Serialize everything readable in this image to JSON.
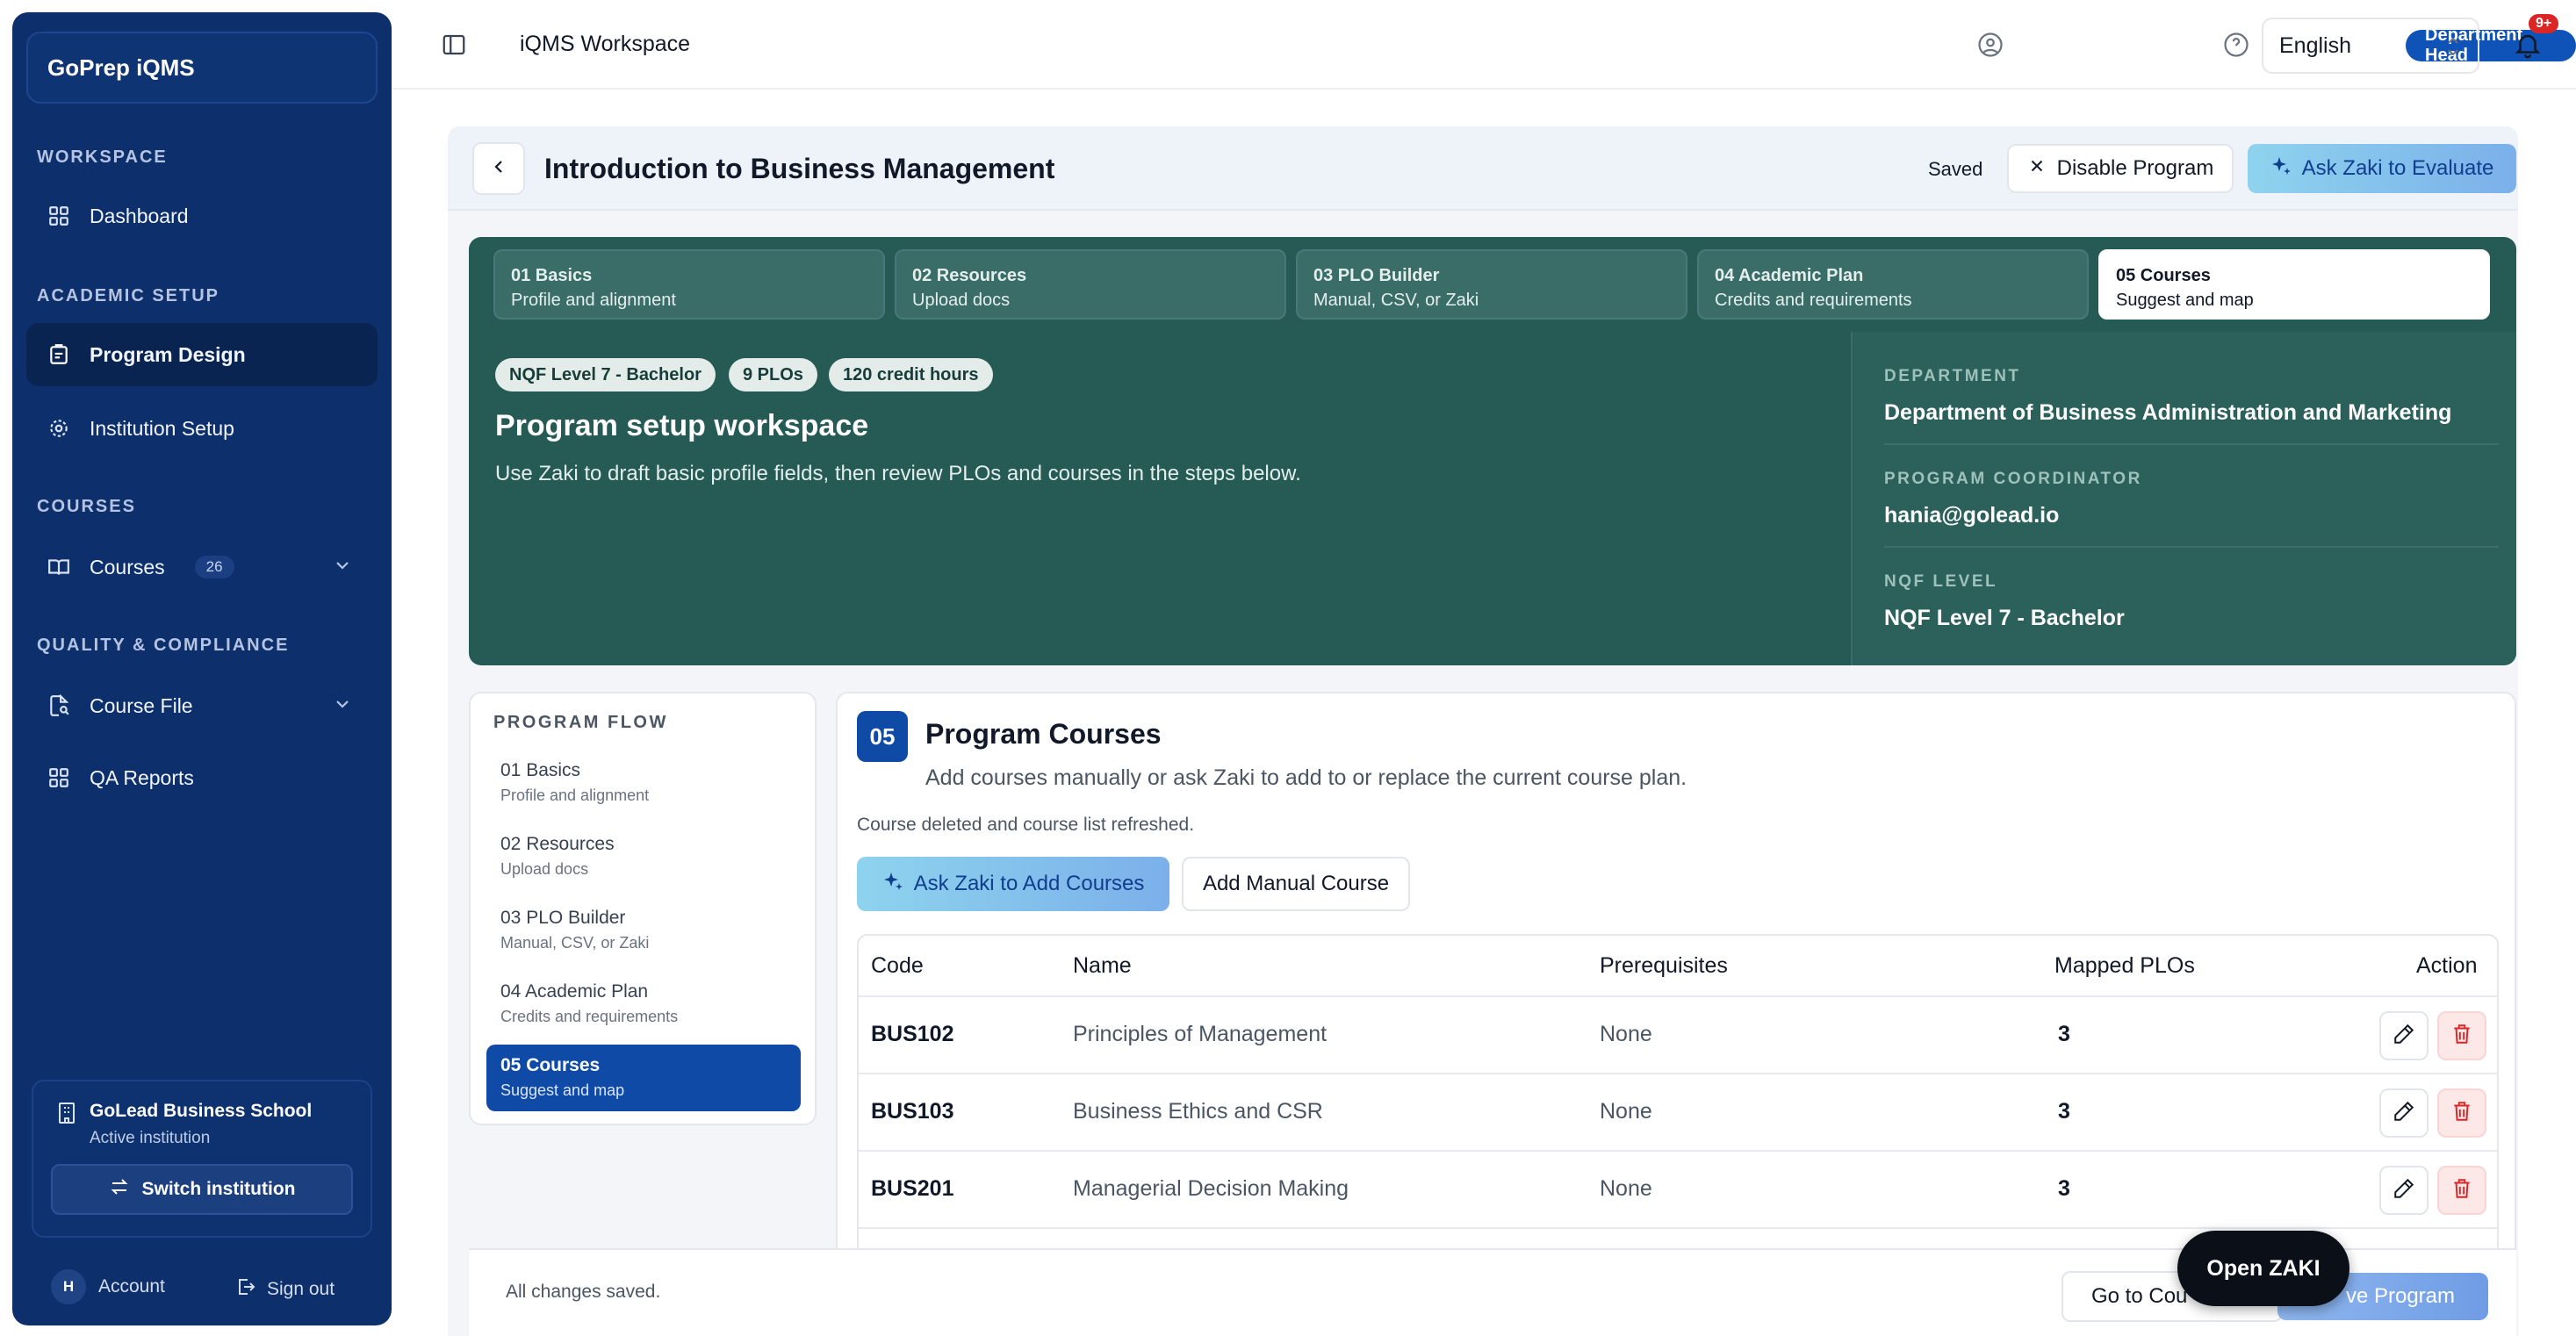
{
  "sidebar": {
    "brand": "GoPrep iQMS",
    "sections": [
      "WORKSPACE",
      "ACADEMIC SETUP",
      "COURSES",
      "QUALITY & COMPLIANCE"
    ],
    "items": [
      {
        "label": "Dashboard",
        "icon": "grid-icon"
      },
      {
        "label": "Program Design",
        "icon": "clipboard-icon"
      },
      {
        "label": "Institution Setup",
        "icon": "gear-icon"
      },
      {
        "label": "Courses",
        "icon": "book-icon",
        "badge": "26"
      },
      {
        "label": "Course File",
        "icon": "file-search-icon"
      },
      {
        "label": "QA Reports",
        "icon": "grid-icon"
      }
    ],
    "institution": {
      "name": "GoLead Business School",
      "status": "Active institution",
      "switch_label": "Switch institution"
    },
    "account": {
      "avatar": "H",
      "label": "Account",
      "signout": "Sign out"
    }
  },
  "topbar": {
    "title": "iQMS Workspace",
    "role": "Department Head",
    "language": "English",
    "notifications": "9+"
  },
  "header": {
    "title": "Introduction to Business Management",
    "saved": "Saved",
    "disable_label": "Disable Program",
    "evaluate_label": "Ask Zaki to Evaluate"
  },
  "steps": [
    {
      "title": "01 Basics",
      "desc": "Profile and alignment"
    },
    {
      "title": "02 Resources",
      "desc": "Upload docs"
    },
    {
      "title": "03 PLO Builder",
      "desc": "Manual, CSV, or Zaki"
    },
    {
      "title": "04 Academic Plan",
      "desc": "Credits and requirements"
    },
    {
      "title": "05 Courses",
      "desc": "Suggest and map"
    }
  ],
  "hero": {
    "pills": [
      "NQF Level 7 - Bachelor",
      "9 PLOs",
      "120 credit hours"
    ],
    "title": "Program setup workspace",
    "subtitle": "Use Zaki to draft basic profile fields, then review PLOs and courses in the steps below.",
    "details": [
      {
        "key": "DEPARTMENT",
        "value": "Department of Business Administration and Marketing"
      },
      {
        "key": "PROGRAM COORDINATOR",
        "value": "hania@golead.io"
      },
      {
        "key": "NQF LEVEL",
        "value": "NQF Level 7 - Bachelor"
      }
    ]
  },
  "flow": {
    "title": "PROGRAM FLOW",
    "items": [
      {
        "title": "01 Basics",
        "desc": "Profile and alignment"
      },
      {
        "title": "02 Resources",
        "desc": "Upload docs"
      },
      {
        "title": "03 PLO Builder",
        "desc": "Manual, CSV, or Zaki"
      },
      {
        "title": "04 Academic Plan",
        "desc": "Credits and requirements"
      },
      {
        "title": "05 Courses",
        "desc": "Suggest and map"
      }
    ]
  },
  "courses": {
    "number": "05",
    "title": "Program Courses",
    "subtitle": "Add courses manually or ask Zaki to add to or replace the current course plan.",
    "message": "Course deleted and course list refreshed.",
    "ask_label": "Ask Zaki to Add Courses",
    "manual_label": "Add Manual Course",
    "columns": [
      "Code",
      "Name",
      "Prerequisites",
      "Mapped PLOs",
      "Action"
    ],
    "rows": [
      {
        "code": "BUS102",
        "name": "Principles of Management",
        "prereq": "None",
        "plos": "3"
      },
      {
        "code": "BUS103",
        "name": "Business Ethics and CSR",
        "prereq": "None",
        "plos": "3"
      },
      {
        "code": "BUS201",
        "name": "Managerial Decision Making",
        "prereq": "None",
        "plos": "3"
      }
    ]
  },
  "footer": {
    "status": "All changes saved.",
    "goto_label": "Go to Cou",
    "save_label": "ve Program"
  },
  "open_zaki": "Open ZAKI"
}
